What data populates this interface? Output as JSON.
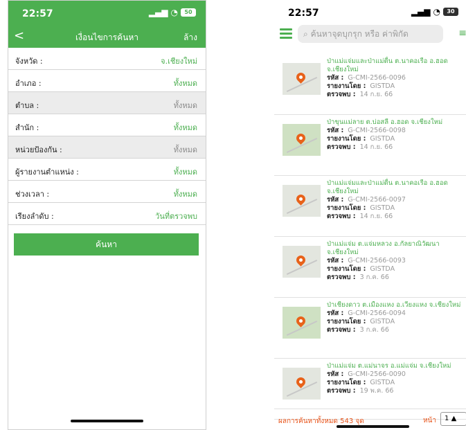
{
  "left": {
    "status_time": "22:57",
    "battery": "50",
    "nav": {
      "back": "<",
      "title": "เงื่อนไขการค้นหา",
      "clear": "ล้าง"
    },
    "rows": [
      {
        "label": "จังหวัด :",
        "value": "จ.เชียงใหม่",
        "tone": "green"
      },
      {
        "label": "อำเภอ :",
        "value": "ทั้งหมด",
        "tone": "green"
      },
      {
        "label": "ตำบล :",
        "value": "ทั้งหมด",
        "tone": "gray"
      },
      {
        "label": "สำนัก :",
        "value": "ทั้งหมด",
        "tone": "green"
      },
      {
        "label": "หน่วยป้องกัน :",
        "value": "ทั้งหมด",
        "tone": "gray"
      },
      {
        "label": "ผู้รายงานตำแหน่ง :",
        "value": "ทั้งหมด",
        "tone": "green"
      },
      {
        "label": "ช่วงเวลา :",
        "value": "ทั้งหมด",
        "tone": "green"
      },
      {
        "label": "เรียงลำดับ :",
        "value": "วันที่ตรวจพบ",
        "tone": "green"
      }
    ],
    "search_button": "ค้นหา"
  },
  "right": {
    "status_time": "22:57",
    "battery": "30",
    "search_placeholder": "ค้นหาจุดบุกรุก หรือ ค่าพิกัด",
    "labels": {
      "code": "รหัส :",
      "reporter": "รายงานโดย :",
      "found": "ตรวจพบ :"
    },
    "items": [
      {
        "name": "ป่าแม่แจ่มและป่าแม่ตื่น ต.นาคอเรือ อ.ฮอด จ.เชียงใหม่",
        "code": "G-CMI-2566-0096",
        "reporter": "GISTDA",
        "date": "14 ก.ย. 66",
        "map_tone": "gray"
      },
      {
        "name": "ป่าขุนแม่ลาย ต.บ่อสลี อ.ฮอด จ.เชียงใหม่",
        "code": "G-CMI-2566-0098",
        "reporter": "GISTDA",
        "date": "14 ก.ย. 66",
        "map_tone": "green"
      },
      {
        "name": "ป่าแม่แจ่มและป่าแม่ตื่น ต.นาคอเรือ อ.ฮอด จ.เชียงใหม่",
        "code": "G-CMI-2566-0097",
        "reporter": "GISTDA",
        "date": "14 ก.ย. 66",
        "map_tone": "gray"
      },
      {
        "name": "ป่าแม่แจ่ม ต.แจ่มหลวง อ.กัลยาณิวัฒนา จ.เชียงใหม่",
        "code": "G-CMI-2566-0093",
        "reporter": "GISTDA",
        "date": "3 ก.ค. 66",
        "map_tone": "gray"
      },
      {
        "name": "ป่าเชียงดาว ต.เมืองแหง อ.เวียงแหง จ.เชียงใหม่",
        "code": "G-CMI-2566-0094",
        "reporter": "GISTDA",
        "date": "3 ก.ค. 66",
        "map_tone": "green"
      },
      {
        "name": "ป่าแม่แจ่ม ต.แม่นาจร อ.แม่แจ่ม จ.เชียงใหม่",
        "code": "G-CMI-2566-0090",
        "reporter": "GISTDA",
        "date": "19 พ.ค. 66",
        "map_tone": "gray"
      }
    ],
    "footer": {
      "results": "ผลการค้นหาทั้งหมด 543 จุด",
      "page_label": "หน้า",
      "page_value": "1"
    }
  },
  "colors": {
    "accent": "#4caf50",
    "alert": "#e8541a"
  }
}
